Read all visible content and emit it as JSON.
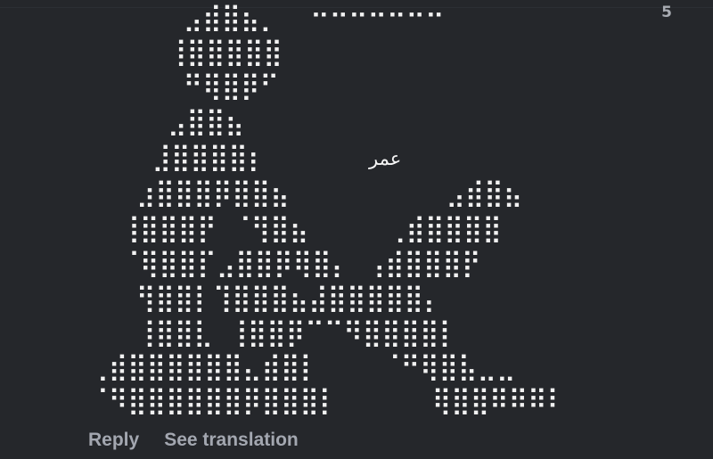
{
  "message": {
    "corner_indicator": "5",
    "name_text": "عمر",
    "braille_art": [
      {
        "text": "      ⣠⣾⣿⣦⡀  ⠒⠒⠒⠒⠒⠒⠒"
      },
      {
        "text": "     ⢸⣿⣿⣿⣿⣿"
      },
      {
        "text": "      ⠛⢿⣿⡿⠋"
      },
      {
        "text": "     ⣠⣿⣿⣦"
      },
      {
        "text": "    ⣸⣿⣿⣿⣿⡆"
      },
      {
        "text": "   ⣰⣿⣿⣿⡿⣿⣿⣦          ⣠⣾⣿⣦"
      },
      {
        "text": "  ⢸⣿⣿⣿⡟ ⠈⢻⣿⣦     ⢀⣾⣿⣿⣿⣿"
      },
      {
        "text": "  ⠈⢿⣿⣿⡏⣠⣿⣿⡿⢿⣿⡄ ⢠⣾⣿⣿⣿⡟"
      },
      {
        "text": "   ⢻⣿⣿⡇⢹⣿⣿⣿⣦⣼⣿⣿⣿⣿⣿⡄"
      },
      {
        "text": "   ⢸⣿⣿⣇ ⢸⣿⣿⡿⠉⠉⠻⣿⣿⣿⣿⡇"
      },
      {
        "text": "⢀⣾⣿⣿⣿⣿⣿⣿⣄⣾⣿⡇    ⠈⠛⢿⣿⣧⣀⣀"
      },
      {
        "text": "⠈⠻⣿⣿⣿⣿⣿⣿⡿⣿⣿⣿⡇      ⢿⣿⣿⠿⠿⠿⠇"
      }
    ]
  },
  "actions": {
    "reply_label": "Reply",
    "see_translation_label": "See translation"
  },
  "colors": {
    "background": "#25272b",
    "art": "#f2f2f2",
    "action_text": "#a3a7b0"
  }
}
